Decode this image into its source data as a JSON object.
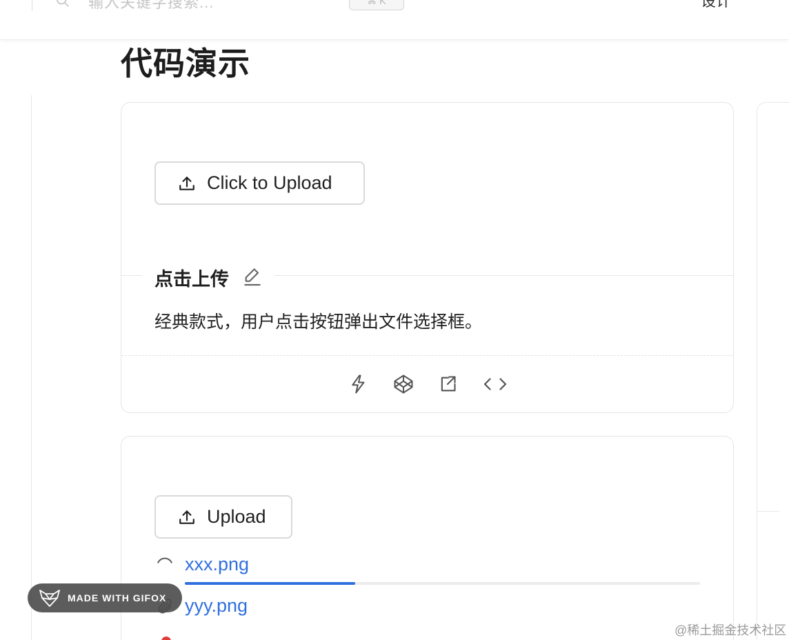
{
  "header": {
    "search_placeholder": "输入关键字搜索...",
    "shortcut": "⌘ K",
    "nav_label": "设计"
  },
  "page_title": "代码演示",
  "demo1": {
    "button_label": "Click to Upload",
    "title": "点击上传",
    "description": "经典款式，用户点击按钮弹出文件选择框。",
    "actions": [
      "lightning-icon",
      "codepen-icon",
      "external-link-icon",
      "code-icon"
    ]
  },
  "demo2": {
    "button_label": "Upload",
    "files": [
      {
        "name": "xxx.png",
        "status": "uploading",
        "progress": 0.33
      },
      {
        "name": "yyy.png",
        "status": "done"
      }
    ]
  },
  "badge": {
    "label": "MADE WITH GIFOX"
  },
  "watermark": "@稀土掘金技术社区",
  "colors": {
    "link": "#2f6fde",
    "progress": "#2f6fde",
    "error": "#e23c3c"
  }
}
